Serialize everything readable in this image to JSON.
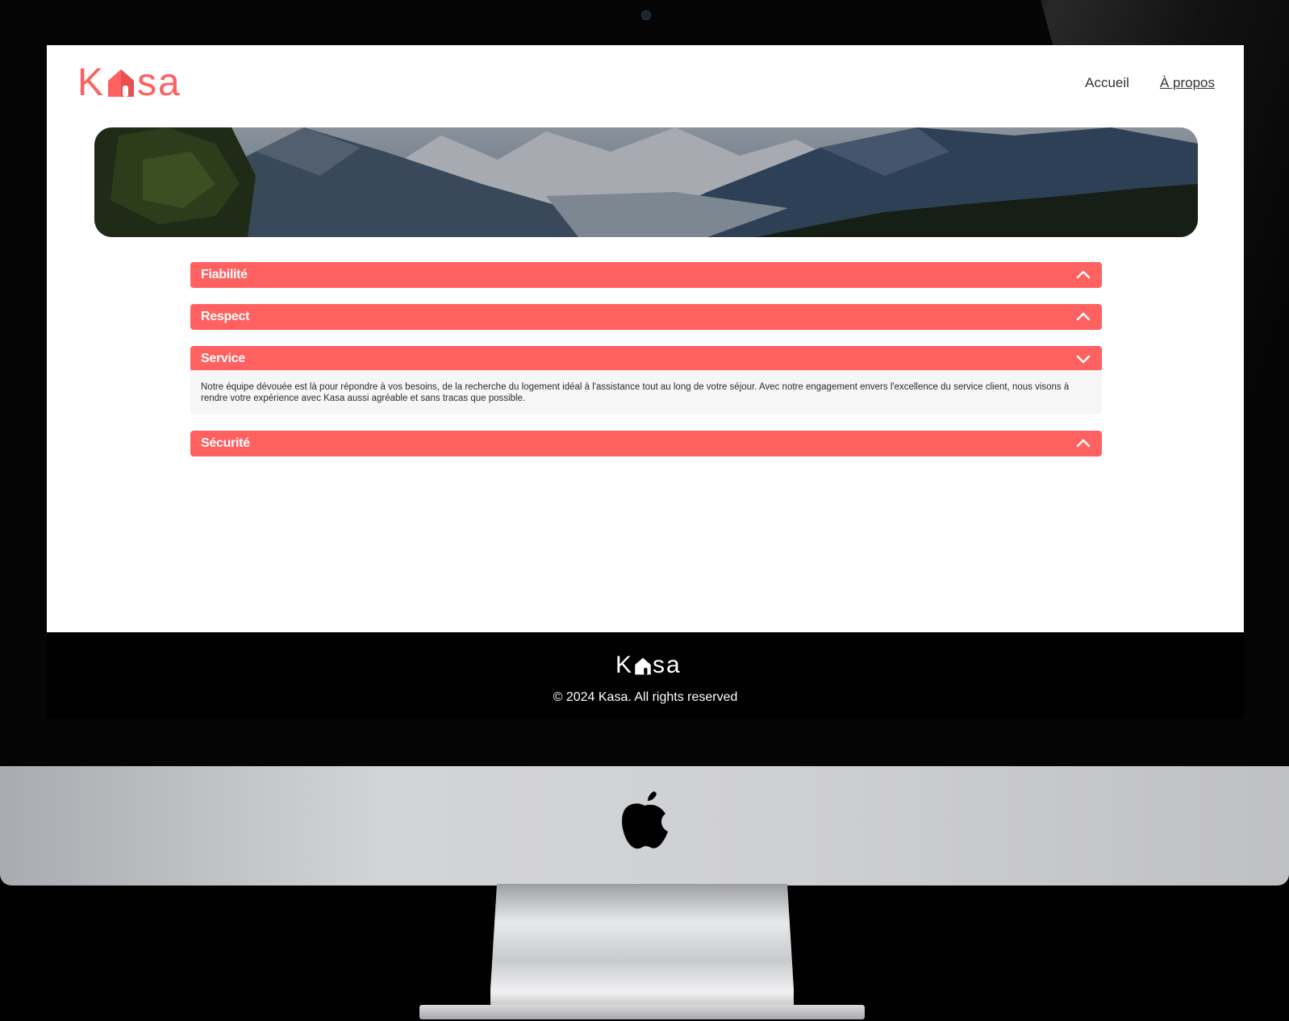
{
  "brand": {
    "name_start": "K",
    "name_end": "sa",
    "accent_color": "#FF6060"
  },
  "nav": {
    "items": [
      {
        "label": "Accueil",
        "active": false
      },
      {
        "label": "À propos",
        "active": true
      }
    ]
  },
  "banner": {
    "image": "mountain-landscape"
  },
  "collapses": [
    {
      "title": "Fiabilité",
      "open": false,
      "icon": "chevron-up-icon"
    },
    {
      "title": "Respect",
      "open": false,
      "icon": "chevron-up-icon"
    },
    {
      "title": "Service",
      "open": true,
      "icon": "chevron-down-icon",
      "content": "Notre équipe dévouée est là pour répondre à vos besoins, de la recherche du logement idéal à l'assistance tout au long de votre séjour. Avec notre engagement envers l'excellence du service client, nous visons à rendre votre expérience avec Kasa aussi agréable et sans tracas que possible."
    },
    {
      "title": "Sécurité",
      "open": false,
      "icon": "chevron-up-icon"
    }
  ],
  "footer": {
    "logo_start": "K",
    "logo_end": "sa",
    "copyright": "© 2024 Kasa. All rights reserved"
  },
  "device": {
    "type": "imac-mockup",
    "logo_icon": "apple-logo-icon"
  }
}
